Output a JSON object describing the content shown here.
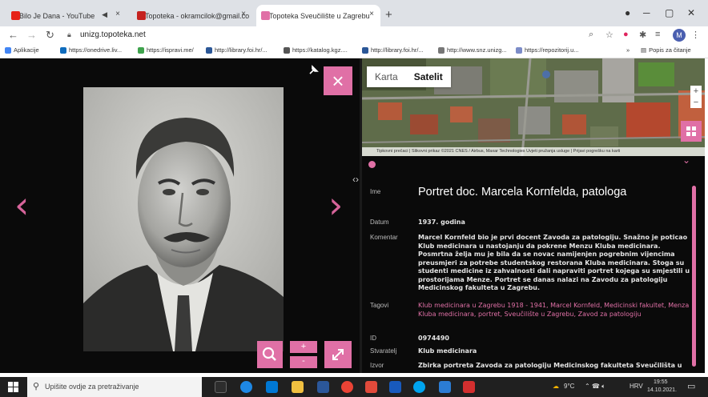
{
  "browser": {
    "tabs": [
      {
        "title": "Bilo Je Dana - YouTube",
        "favicon_color": "#e62117"
      },
      {
        "title": "Topoteka - okramcilok@gmail.co",
        "favicon_color": "#c5221f"
      },
      {
        "title": "Topoteka Sveučilište u Zagrebu",
        "favicon_color": "#e070a6"
      }
    ],
    "new_tab": "+",
    "url": "unizg.topoteka.net",
    "avatar_letter": "M",
    "bookmarks": [
      {
        "label": "Aplikacije",
        "color": "#4285f4"
      },
      {
        "label": "https://onedrive.liv...",
        "color": "#0f6cbd"
      },
      {
        "label": "https://ispravi.me/",
        "color": "#3fa34d"
      },
      {
        "label": "http://library.foi.hr/...",
        "color": "#2b5797"
      },
      {
        "label": "https://katalog.kgz....",
        "color": "#555555"
      },
      {
        "label": "http://library.foi.hr/...",
        "color": "#2b5797"
      },
      {
        "label": "http://www.snz.unizg...",
        "color": "#777777"
      },
      {
        "label": "https://repozitorij.u...",
        "color": "#7c8cc8"
      }
    ],
    "bookmarks_more": "»",
    "reading_list": "Popis za čitanje"
  },
  "viewer": {
    "close": "×",
    "zoom_in": "+",
    "zoom_out": "-",
    "prev": "‹",
    "next": "›"
  },
  "map": {
    "tab_map": "Karta",
    "tab_satellite": "Satelit",
    "attribution": "Tipkovni prečaci | Slikovni prikaz ©2021 CNES / Airbus, Maxar Technologies   Uvjeti pružanja usluge | Prijavi pogrešku na karti",
    "zoom_in": "+",
    "zoom_out": "−"
  },
  "details": {
    "fields": [
      {
        "label": "Ime",
        "value": "Portret doc. Marcela Kornfelda, patologa"
      },
      {
        "label": "Datum",
        "value": "1937. godina"
      },
      {
        "label": "Komentar",
        "value": "Marcel Kornfeld bio je prvi docent Zavoda za patologiju. Snažno je poticao Klub medicinara u nastojanju da pokrene Menzu Kluba medicinara. Posmrtna želja mu je bila da se novac namijenjen pogrebnim vijencima preusmjeri za potrebe studentskog restorana Kluba medicinara. Stoga su studenti medicine iz zahvalnosti dali napraviti portret kojega su smjestili u prostorijama Menze. Portret se danas nalazi na Zavodu za patologiju Medicinskog fakulteta u Zagrebu."
      },
      {
        "label": "Tagovi",
        "value": "Klub medicinara u Zagrebu 1918 - 1941, Marcel Kornfeld, Medicinski fakultet, Menza Kluba medicinara, portret, Sveučilište u Zagrebu, Zavod za patologiju"
      },
      {
        "label": "ID",
        "value": "0974490"
      },
      {
        "label": "Stvaratelj",
        "value": "Klub medicinara"
      },
      {
        "label": "Izvor",
        "value": "Zbirka portreta Zavoda za patologiju Medicinskog fakulteta Sveučilišta u"
      }
    ]
  },
  "taskbar": {
    "search_placeholder": "Upišite ovdje za pretraživanje",
    "weather": "9°C",
    "lang": "HRV",
    "time": "19:55",
    "date": "14.10.2021."
  },
  "colors": {
    "accent": "#e070a6"
  }
}
